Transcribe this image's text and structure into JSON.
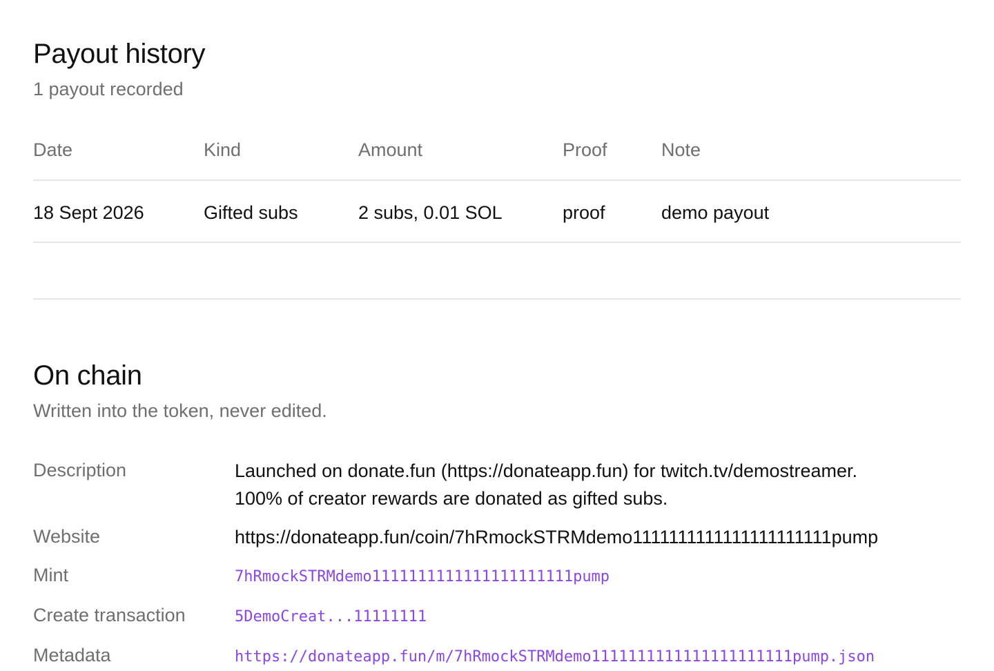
{
  "payout": {
    "title": "Payout history",
    "subtitle": "1 payout recorded",
    "columns": {
      "date": "Date",
      "kind": "Kind",
      "amount": "Amount",
      "proof": "Proof",
      "note": "Note"
    },
    "rows": [
      {
        "date": "18 Sept 2026",
        "kind": "Gifted subs",
        "amount": "2 subs, 0.01 SOL",
        "proof": "proof",
        "note": "demo payout"
      }
    ]
  },
  "chain": {
    "title": "On chain",
    "subtitle": "Written into the token, never edited.",
    "description_label": "Description",
    "description_line1": "Launched on donate.fun (https://donateapp.fun) for twitch.tv/demostreamer.",
    "description_line2": "100% of creator rewards are donated as gifted subs.",
    "website_label": "Website",
    "website_value": "https://donateapp.fun/coin/7hRmockSTRMdemo1111111111111111111111pump",
    "mint_label": "Mint",
    "mint_value": "7hRmockSTRMdemo1111111111111111111111pump",
    "create_tx_label": "Create transaction",
    "create_tx_value": "5DemoCreat...11111111",
    "metadata_label": "Metadata",
    "metadata_value": "https://donateapp.fun/m/7hRmockSTRMdemo1111111111111111111111pump.json"
  },
  "colors": {
    "accent": "#8b46e6",
    "muted": "#6f6f6f",
    "divider": "#e6e6e6"
  }
}
